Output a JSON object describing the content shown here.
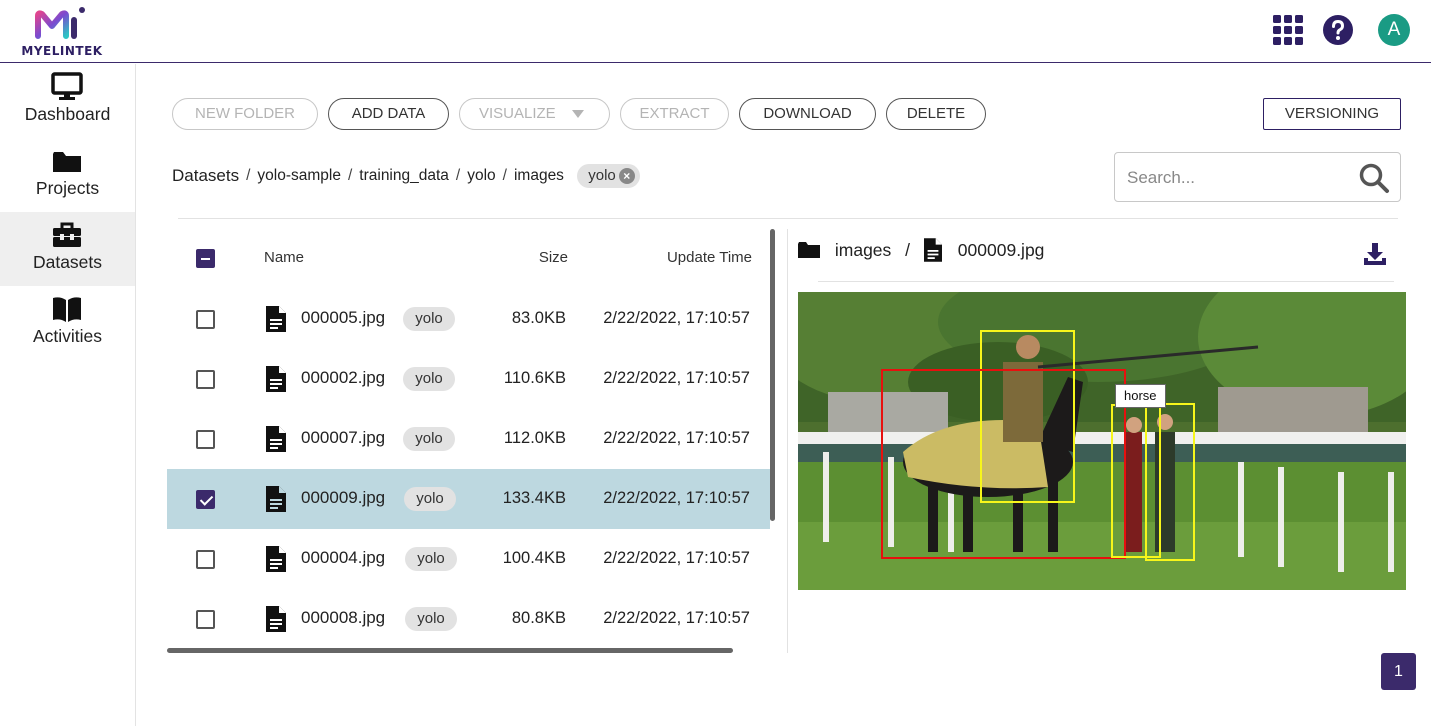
{
  "brand": {
    "name": "MyelinTek"
  },
  "header": {
    "apps_icon": "apps-grid-icon",
    "help_icon": "help-icon",
    "avatar_initial": "A",
    "avatar_color": "#1a9b84",
    "accent_color": "#3b2a6b"
  },
  "sidebar": {
    "items": [
      {
        "label": "Dashboard",
        "icon": "monitor-icon",
        "active": false
      },
      {
        "label": "Projects",
        "icon": "folder-icon",
        "active": false
      },
      {
        "label": "Datasets",
        "icon": "toolbox-icon",
        "active": true
      },
      {
        "label": "Activities",
        "icon": "book-icon",
        "active": false
      }
    ]
  },
  "toolbar": {
    "new_folder": "NEW FOLDER",
    "add_data": "ADD DATA",
    "visualize": "VISUALIZE",
    "extract": "EXTRACT",
    "download": "DOWNLOAD",
    "delete": "DELETE",
    "versioning": "VERSIONING"
  },
  "breadcrumb": {
    "items": [
      "Datasets",
      "yolo-sample",
      "training_data",
      "yolo",
      "images"
    ],
    "separator": "/",
    "filter_chip": "yolo"
  },
  "search": {
    "placeholder": "Search..."
  },
  "table": {
    "headers": {
      "name": "Name",
      "size": "Size",
      "update_time": "Update Time"
    },
    "rows": [
      {
        "name": "000005.jpg",
        "tag": "yolo",
        "size": "83.0KB",
        "time": "2/22/2022, 17:10:57",
        "checked": false
      },
      {
        "name": "000002.jpg",
        "tag": "yolo",
        "size": "110.6KB",
        "time": "2/22/2022, 17:10:57",
        "checked": false
      },
      {
        "name": "000007.jpg",
        "tag": "yolo",
        "size": "112.0KB",
        "time": "2/22/2022, 17:10:57",
        "checked": false
      },
      {
        "name": "000009.jpg",
        "tag": "yolo",
        "size": "133.4KB",
        "time": "2/22/2022, 17:10:57",
        "checked": true
      },
      {
        "name": "000004.jpg",
        "tag": "yolo",
        "size": "100.4KB",
        "time": "2/22/2022, 17:10:57",
        "checked": false
      },
      {
        "name": "000008.jpg",
        "tag": "yolo",
        "size": "80.8KB",
        "time": "2/22/2022, 17:10:57",
        "checked": false
      }
    ]
  },
  "preview": {
    "folder": "images",
    "file": "000009.jpg",
    "hover_label": "horse",
    "box_colors": {
      "default": "#f7f61b",
      "hovered": "#e8100e"
    }
  },
  "pagination": {
    "current": "1"
  }
}
